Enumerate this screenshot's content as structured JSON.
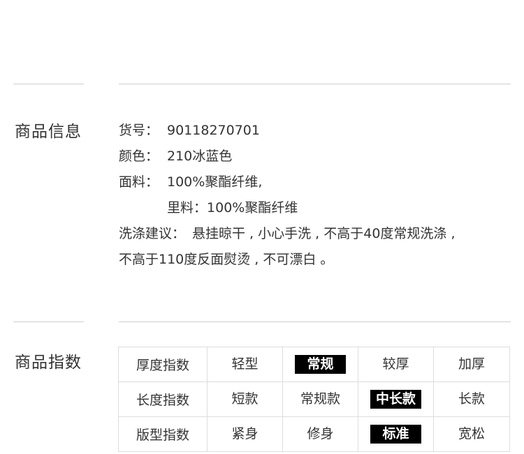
{
  "info_section": {
    "title": "商品信息",
    "sku_label": "货号：",
    "sku_value": "90118270701",
    "color_label": "颜色：",
    "color_value": "210冰蓝色",
    "fabric_label": "面料：",
    "fabric_value": "100%聚酯纤维,",
    "lining_label": "里料：",
    "lining_value": "100%聚酯纤维",
    "care_label": "洗涤建议：",
    "care_value_1": "悬挂晾干 , 小心手洗 , 不高于40度常规洗涤 ,",
    "care_value_2": "不高于110度反面熨烫 , 不可漂白 。"
  },
  "index_section": {
    "title": "商品指数",
    "rows": [
      {
        "label": "厚度指数",
        "options": [
          "轻型",
          "常规",
          "较厚",
          "加厚"
        ],
        "selected_index": 1
      },
      {
        "label": "长度指数",
        "options": [
          "短款",
          "常规款",
          "中长款",
          "长款"
        ],
        "selected_index": 2
      },
      {
        "label": "版型指数",
        "options": [
          "紧身",
          "修身",
          "标准",
          "宽松"
        ],
        "selected_index": 2
      }
    ]
  },
  "colors": {
    "text": "#333333",
    "rule": "#cfcfcf",
    "table_border": "#dddddd",
    "selected_bg": "#000000",
    "selected_text": "#ffffff"
  }
}
